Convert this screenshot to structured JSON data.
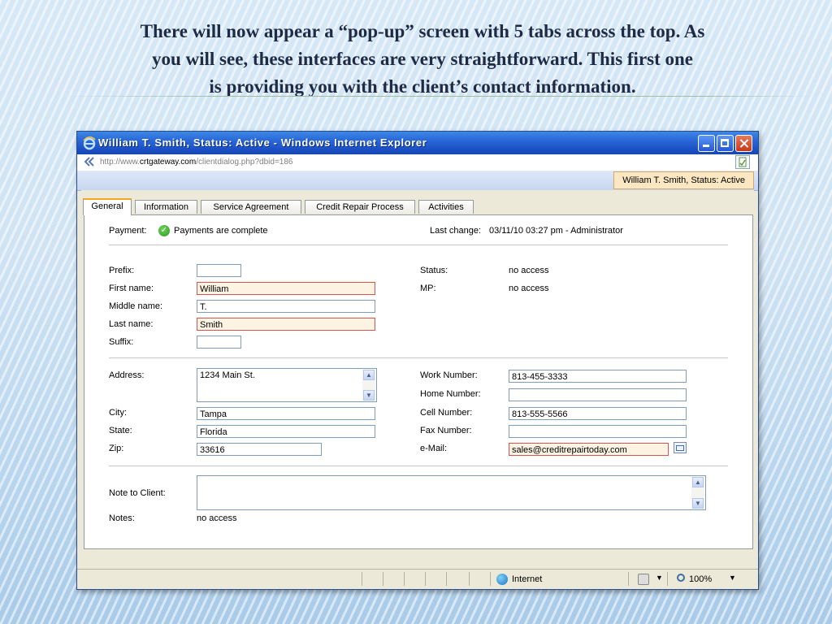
{
  "caption": {
    "line1": "There will now appear a “pop-up” screen with 5 tabs across the top.  As",
    "line2": "you will see, these interfaces are very straightforward. This first one",
    "line3": "is providing you with the client’s contact information."
  },
  "window": {
    "title": "William T. Smith, Status: Active - Windows Internet Explorer",
    "address_prefix": "http://www.",
    "address_domain": "crtgateway.com",
    "address_path": "/clientdialog.php?dbid=186",
    "status_chip": "William T. Smith, Status: Active"
  },
  "tabs": [
    "General",
    "Information",
    "Service Agreement",
    "Credit Repair Process",
    "Activities"
  ],
  "active_tab": "General",
  "payment": {
    "label": "Payment:",
    "status": "Payments are complete",
    "last_change_label": "Last change:",
    "last_change_value": "03/11/10 03:27 pm - Administrator"
  },
  "name": {
    "prefix_label": "Prefix:",
    "prefix_value": "",
    "first_label": "First name:",
    "first_value": "William",
    "middle_label": "Middle name:",
    "middle_value": "T.",
    "last_label": "Last name:",
    "last_value": "Smith",
    "suffix_label": "Suffix:",
    "suffix_value": ""
  },
  "access": {
    "status_label": "Status:",
    "status_value": "no access",
    "mp_label": "MP:",
    "mp_value": "no access"
  },
  "address": {
    "address_label": "Address:",
    "address_value": "1234 Main St.",
    "city_label": "City:",
    "city_value": "Tampa",
    "state_label": "State:",
    "state_value": "Florida",
    "zip_label": "Zip:",
    "zip_value": "33616"
  },
  "contact": {
    "work_label": "Work Number:",
    "work_value": "813-455-3333",
    "home_label": "Home Number:",
    "home_value": "",
    "cell_label": "Cell Number:",
    "cell_value": "813-555-5566",
    "fax_label": "Fax Number:",
    "fax_value": "",
    "email_label": "e-Mail:",
    "email_value": "sales@creditrepairtoday.com"
  },
  "notes": {
    "note_to_client_label": "Note to Client:",
    "note_to_client_value": "",
    "notes_label": "Notes:",
    "notes_value": "no access"
  },
  "statusbar": {
    "zone": "Internet",
    "zoom": "100%"
  },
  "colors": {
    "titlebar": "#1a4fc4",
    "required_border": "#d9534f",
    "status_chip_bg": "#fbe7c1",
    "tab_highlight": "#f5a623"
  },
  "icons": [
    "ie-logo-icon",
    "page-back-icon",
    "page-icon",
    "checkmark-icon",
    "mail-icon",
    "globe-icon",
    "lock-icon",
    "zoom-icon"
  ]
}
